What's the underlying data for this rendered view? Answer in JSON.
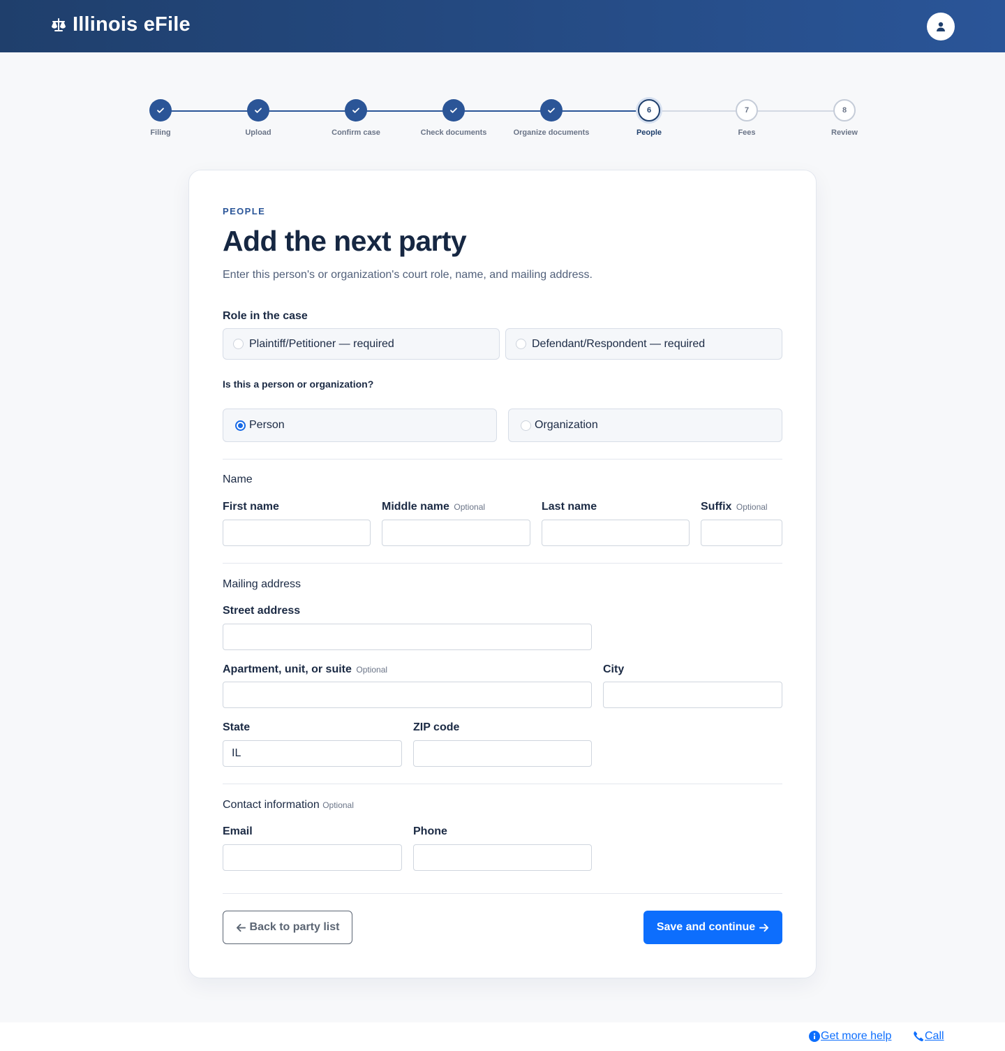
{
  "header": {
    "brand": "Illinois eFile"
  },
  "stepper": {
    "steps": [
      {
        "label": "Filing",
        "state": "done"
      },
      {
        "label": "Upload",
        "state": "done"
      },
      {
        "label": "Confirm case",
        "state": "done"
      },
      {
        "label": "Check documents",
        "state": "done"
      },
      {
        "label": "Organize documents",
        "state": "done"
      },
      {
        "label": "People",
        "number": "6",
        "state": "current"
      },
      {
        "label": "Fees",
        "number": "7",
        "state": "todo"
      },
      {
        "label": "Review",
        "number": "8",
        "state": "todo"
      }
    ]
  },
  "form": {
    "eyebrow": "PEOPLE",
    "title": "Add the next party",
    "subtitle": "Enter this person's or organization's court role, name, and mailing address.",
    "role": {
      "label": "Role in the case",
      "options": [
        "Plaintiff/Petitioner — required",
        "Defendant/Respondent — required"
      ],
      "selected": null
    },
    "party_type": {
      "label": "Is this a person or organization?",
      "options": [
        "Person",
        "Organization"
      ],
      "selected": "Person"
    },
    "name_section": {
      "heading": "Name",
      "first_name": {
        "label": "First name",
        "value": ""
      },
      "middle_name": {
        "label": "Middle name",
        "optional": "Optional",
        "value": ""
      },
      "last_name": {
        "label": "Last name",
        "value": ""
      },
      "suffix": {
        "label": "Suffix",
        "optional": "Optional",
        "value": ""
      }
    },
    "address_section": {
      "heading": "Mailing address",
      "street": {
        "label": "Street address",
        "value": ""
      },
      "apartment": {
        "label": "Apartment, unit, or suite",
        "optional": "Optional",
        "value": ""
      },
      "city": {
        "label": "City",
        "value": ""
      },
      "state": {
        "label": "State",
        "value": "IL"
      },
      "zip": {
        "label": "ZIP code",
        "value": ""
      }
    },
    "contact_section": {
      "heading": "Contact information",
      "optional": "Optional",
      "email": {
        "label": "Email",
        "value": ""
      },
      "phone": {
        "label": "Phone",
        "value": ""
      }
    },
    "actions": {
      "back": "Back to party list",
      "save": "Save and continue"
    }
  },
  "footer": {
    "help": "Get more help",
    "call": "Call"
  },
  "colors": {
    "header_start": "#1f3f6c",
    "header_end": "#2a5598",
    "primary": "#0d6efd",
    "step_done": "#2b5597"
  }
}
